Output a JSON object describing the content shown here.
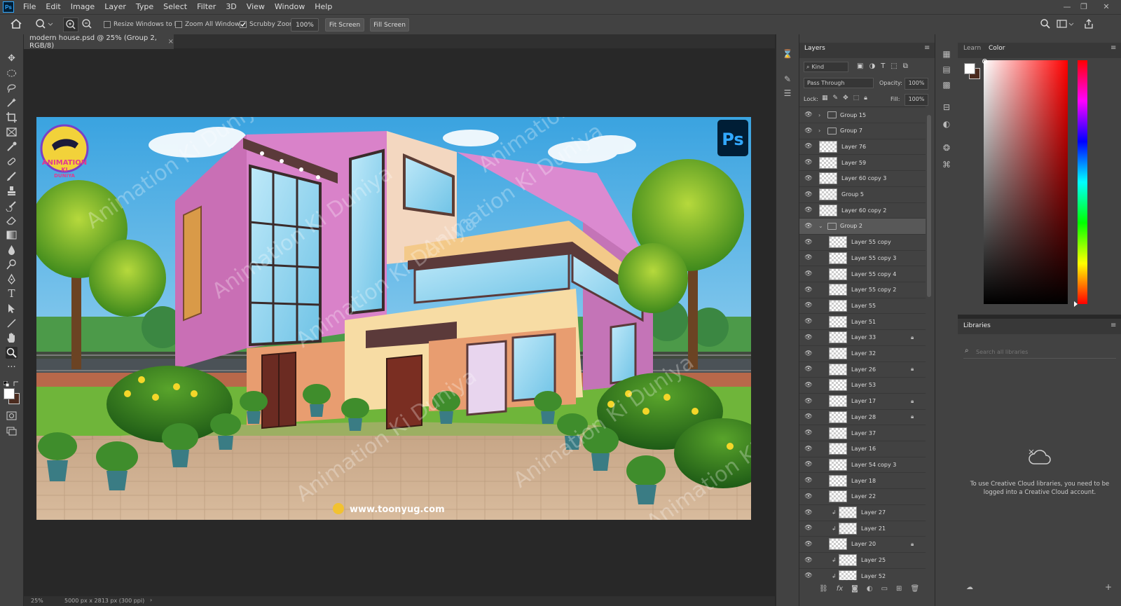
{
  "app": {
    "logo": "Ps"
  },
  "menu": [
    "File",
    "Edit",
    "Image",
    "Layer",
    "Type",
    "Select",
    "Filter",
    "3D",
    "View",
    "Window",
    "Help"
  ],
  "window_controls": [
    "—",
    "❐",
    "✕"
  ],
  "options": {
    "resize_windows": "Resize Windows to Fit",
    "zoom_all": "Zoom All Windows",
    "scrubby_zoom": "Scrubby Zoom",
    "zoom_value": "100%",
    "fit_screen": "Fit Screen",
    "fill_screen": "Fill Screen"
  },
  "document": {
    "tab_title": "modern house.psd @ 25% (Group 2, RGB/8)",
    "close": "×"
  },
  "status": {
    "zoom": "25%",
    "doc_info": "5000 px x 2813 px (300 ppi)",
    "arrow": "›"
  },
  "artwork": {
    "watermark": "Animation Ki Duniya",
    "url": "www.toonyug.com",
    "ps_badge": "Ps",
    "logo_line1": "ANIMATION",
    "logo_line2": "KI",
    "logo_line3": "DUNIYA"
  },
  "layers_panel": {
    "tab": "Layers",
    "filter_kind": "Kind",
    "blend_mode": "Pass Through",
    "opacity_label": "Opacity:",
    "opacity_value": "100%",
    "lock_label": "Lock:",
    "fill_label": "Fill:",
    "fill_value": "100%",
    "layers": [
      {
        "name": "Group 15",
        "type": "group",
        "indent": 0,
        "locked": false,
        "selected": false
      },
      {
        "name": "Group 7",
        "type": "group",
        "indent": 0,
        "locked": false,
        "selected": false
      },
      {
        "name": "Layer 76",
        "type": "layer",
        "indent": 0,
        "locked": false,
        "selected": false
      },
      {
        "name": "Layer 59",
        "type": "layer",
        "indent": 0,
        "locked": false,
        "selected": false
      },
      {
        "name": "Layer 60 copy 3",
        "type": "layer",
        "indent": 0,
        "locked": false,
        "selected": false
      },
      {
        "name": "Group 5",
        "type": "layer",
        "indent": 0,
        "locked": false,
        "selected": false
      },
      {
        "name": "Layer 60 copy 2",
        "type": "layer",
        "indent": 0,
        "locked": false,
        "selected": false
      },
      {
        "name": "Group 2",
        "type": "group-open",
        "indent": 0,
        "locked": false,
        "selected": true
      },
      {
        "name": "Layer 55 copy",
        "type": "layer",
        "indent": 1,
        "locked": false,
        "selected": false
      },
      {
        "name": "Layer 55 copy 3",
        "type": "layer",
        "indent": 1,
        "locked": false,
        "selected": false
      },
      {
        "name": "Layer 55 copy 4",
        "type": "layer",
        "indent": 1,
        "locked": false,
        "selected": false
      },
      {
        "name": "Layer 55 copy 2",
        "type": "layer",
        "indent": 1,
        "locked": false,
        "selected": false
      },
      {
        "name": "Layer 55",
        "type": "layer",
        "indent": 1,
        "locked": false,
        "selected": false
      },
      {
        "name": "Layer 51",
        "type": "layer",
        "indent": 1,
        "locked": false,
        "selected": false
      },
      {
        "name": "Layer 33",
        "type": "layer",
        "indent": 1,
        "locked": true,
        "selected": false
      },
      {
        "name": "Layer 32",
        "type": "layer",
        "indent": 1,
        "locked": false,
        "selected": false
      },
      {
        "name": "Layer 26",
        "type": "layer",
        "indent": 1,
        "locked": true,
        "selected": false
      },
      {
        "name": "Layer 53",
        "type": "layer",
        "indent": 1,
        "locked": false,
        "selected": false
      },
      {
        "name": "Layer 17",
        "type": "layer",
        "indent": 1,
        "locked": true,
        "selected": false
      },
      {
        "name": "Layer 28",
        "type": "layer",
        "indent": 1,
        "locked": true,
        "selected": false
      },
      {
        "name": "Layer 37",
        "type": "layer",
        "indent": 1,
        "locked": false,
        "selected": false
      },
      {
        "name": "Layer 16",
        "type": "layer",
        "indent": 1,
        "locked": false,
        "selected": false
      },
      {
        "name": "Layer 54 copy 3",
        "type": "layer",
        "indent": 1,
        "locked": false,
        "selected": false
      },
      {
        "name": "Layer 18",
        "type": "layer",
        "indent": 1,
        "locked": false,
        "selected": false
      },
      {
        "name": "Layer 22",
        "type": "layer",
        "indent": 1,
        "locked": false,
        "selected": false
      },
      {
        "name": "Layer 27",
        "type": "clip",
        "indent": 2,
        "locked": false,
        "selected": false
      },
      {
        "name": "Layer 21",
        "type": "clip",
        "indent": 2,
        "locked": false,
        "selected": false
      },
      {
        "name": "Layer 20",
        "type": "layer",
        "indent": 1,
        "locked": true,
        "selected": false
      },
      {
        "name": "Layer 25",
        "type": "clip",
        "indent": 2,
        "locked": false,
        "selected": false
      },
      {
        "name": "Layer 52",
        "type": "clip",
        "indent": 2,
        "locked": false,
        "selected": false
      }
    ],
    "footer_icons": [
      "link-icon",
      "fx-icon",
      "mask-icon",
      "adjustment-icon",
      "new-group-icon",
      "new-layer-icon",
      "trash-icon"
    ]
  },
  "color_panel": {
    "tab_learn": "Learn",
    "tab_color": "Color",
    "hue_color": "#ff0000"
  },
  "libraries_panel": {
    "tab": "Libraries",
    "search_placeholder": "Search all libraries",
    "message": "To use Creative Cloud libraries, you need to be logged into a Creative Cloud account."
  }
}
